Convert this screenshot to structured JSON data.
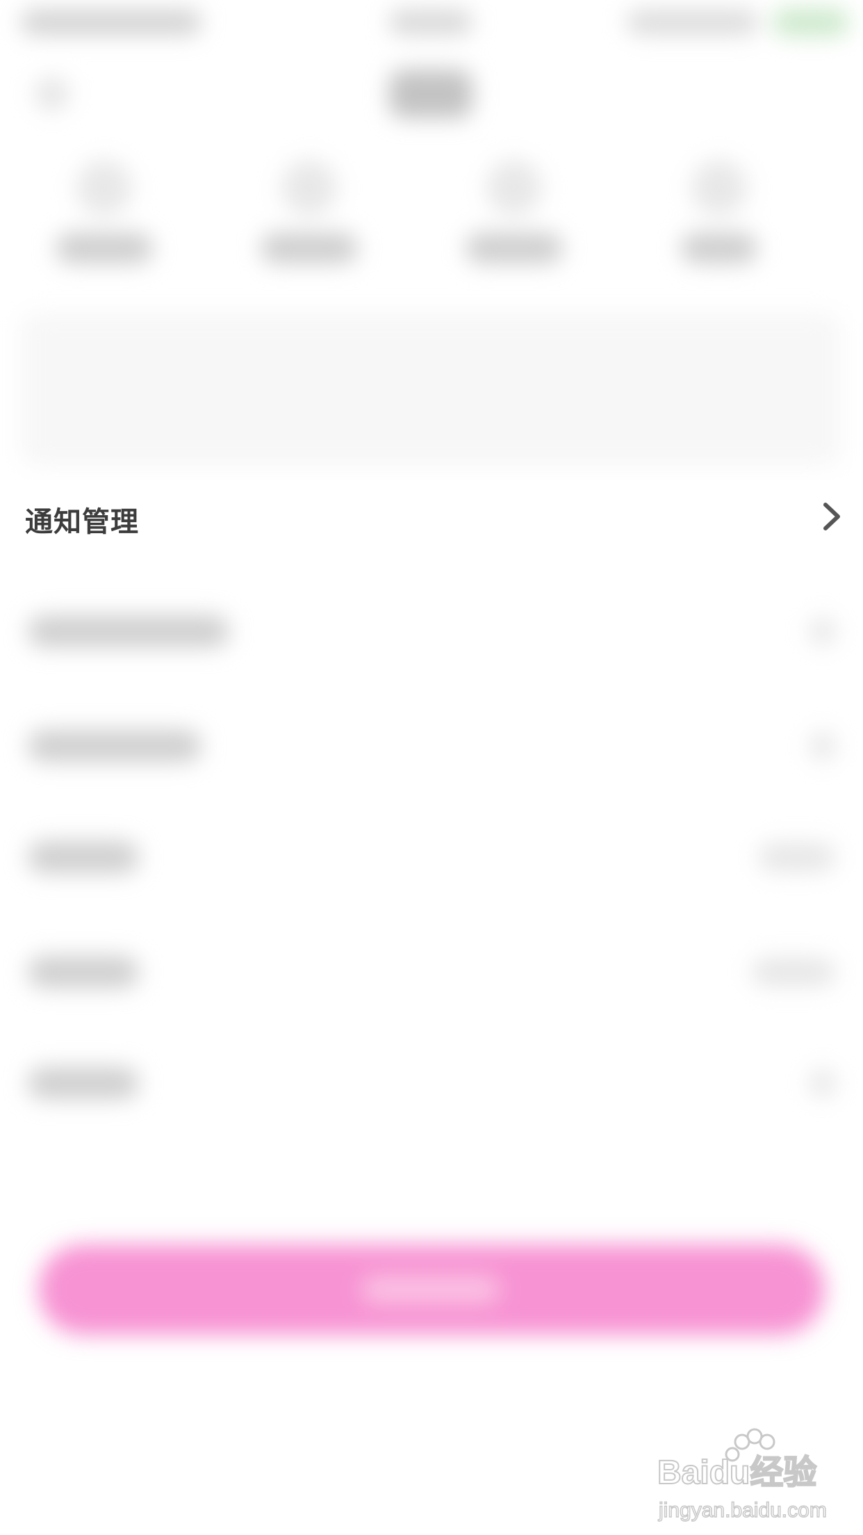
{
  "notification_management": {
    "label": "通知管理",
    "chevron_icon": "chevron-right-icon"
  },
  "watermark": {
    "brand": "Baidu经验",
    "url": "jingyan.baidu.com"
  },
  "colors": {
    "primary_button": "#f793d3",
    "background": "#ffffff",
    "text": "#3c3c3c"
  }
}
